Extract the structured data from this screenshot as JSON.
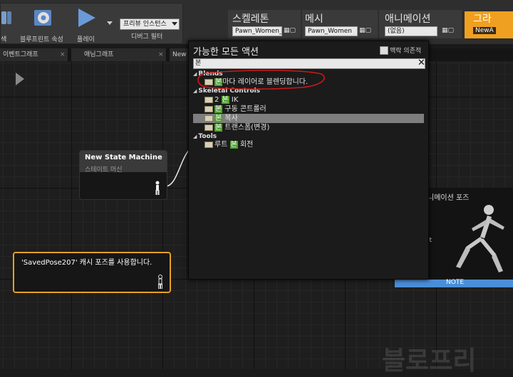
{
  "toolbar": {
    "search_label": "색",
    "blueprint_props_label": "블루프린트 속성",
    "play_label": "플레이",
    "preview_dropdown": "프리뷰 인스턴스",
    "debug_filter_label": "디버그 필터"
  },
  "breadcrumbs": [
    {
      "title": "스켈레톤",
      "value": "Pawn_Women_"
    },
    {
      "title": "메시",
      "value": "Pawn_Women"
    },
    {
      "title": "애니메이션",
      "value": "(없음)"
    },
    {
      "title": "그라",
      "value": "NewA"
    }
  ],
  "tabs": [
    "이벤트그래프",
    "애님그래프",
    "New"
  ],
  "graph": {
    "state_machine_title": "New State Machine",
    "state_machine_subtitle": "스테이트 머신",
    "cache_pose_label": "'SavedPose207' 캐시 포즈를 사용합니다.",
    "anim_pose_title": "니메이션 포즈",
    "side_text": "lt",
    "note_label": "NOTE",
    "watermark": "블로프리"
  },
  "popup": {
    "title": "가능한 모든 액션",
    "context_label": "맥락 의존적",
    "search_value": "본",
    "categories": [
      {
        "name": "Blends",
        "items": [
          {
            "pre": "",
            "hl": "본",
            "post": "마다 레이어로 블렌딩합니다."
          }
        ]
      },
      {
        "name": "Skeletal Controls",
        "items": [
          {
            "pre": "2 ",
            "hl": "본",
            "post": " IK"
          },
          {
            "pre": "",
            "hl": "본",
            "post": " 구동 콘트롤러"
          },
          {
            "pre": "",
            "hl": "본",
            "post": " 복사"
          },
          {
            "pre": "",
            "hl": "본",
            "post": " 트랜스폼(변경)"
          }
        ]
      },
      {
        "name": "Tools",
        "items": [
          {
            "pre": "루트 ",
            "hl": "본",
            "post": " 회전"
          }
        ]
      }
    ]
  },
  "colors": {
    "highlight_green": "#4f9f2f",
    "annotation_red": "#d01818",
    "selected_node_orange": "#e8a020",
    "note_blue": "#4a8ed8",
    "breadcrumb_active": "#f0a020"
  }
}
